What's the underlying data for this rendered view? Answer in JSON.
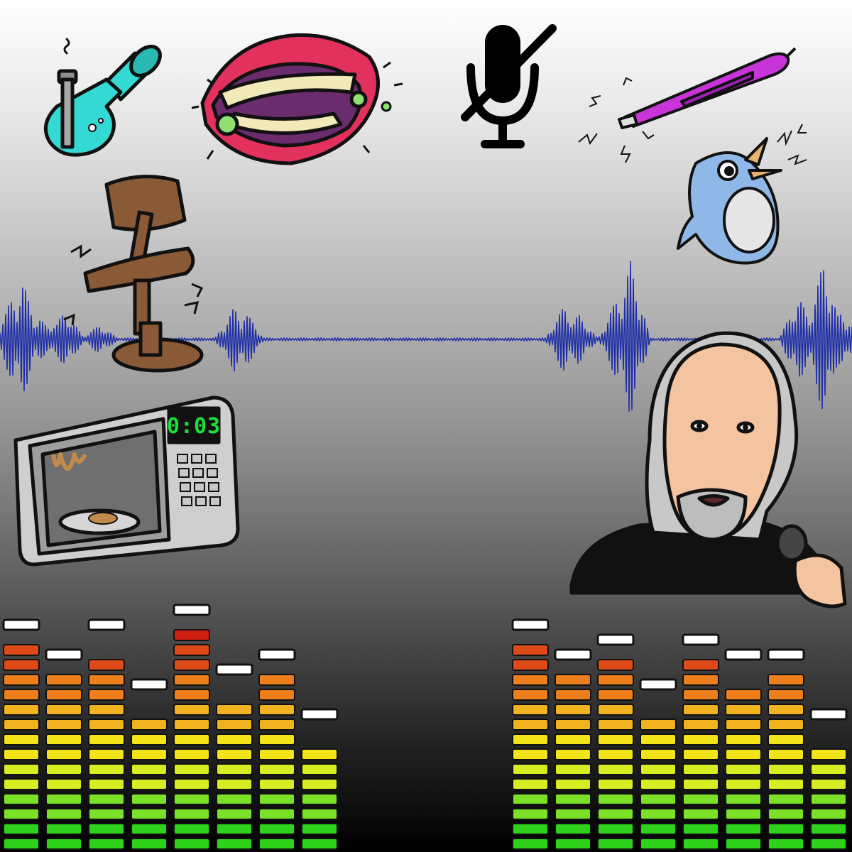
{
  "microwave": {
    "display": "0:03"
  },
  "colors": {
    "waveform": "#1f2fa8",
    "meter_gradient": [
      "#2ed11c",
      "#7be028",
      "#d8ec22",
      "#f2e418",
      "#f0b21e",
      "#ec7e1c",
      "#de4a17",
      "#d01e12"
    ],
    "peak_cap": "#ffffff",
    "bong_glass": "#35d9d3",
    "lips": "#e2315c",
    "pen": "#c734d8",
    "bird": "#8fb8e8",
    "chair": "#8a5a36",
    "microwave_body": "#cfcfcf",
    "shirt": "#111111",
    "skin": "#f4c39f"
  },
  "icons": [
    "bong-icon",
    "teeth-chewing-icon",
    "mic-muted-icon",
    "clicking-pen-icon",
    "chirping-bird-icon",
    "squeaky-chair-icon",
    "microwave-icon",
    "man-with-microphone"
  ],
  "meters": {
    "left": [
      {
        "level": 0.86,
        "peak": 0.93
      },
      {
        "level": 0.73,
        "peak": 0.83
      },
      {
        "level": 0.82,
        "peak": 0.91
      },
      {
        "level": 0.58,
        "peak": 0.68
      },
      {
        "level": 0.92,
        "peak": 1.0
      },
      {
        "level": 0.62,
        "peak": 0.72
      },
      {
        "level": 0.74,
        "peak": 0.83
      },
      {
        "level": 0.45,
        "peak": 0.55
      }
    ],
    "right": [
      {
        "level": 0.86,
        "peak": 0.93
      },
      {
        "level": 0.73,
        "peak": 0.81
      },
      {
        "level": 0.8,
        "peak": 0.88
      },
      {
        "level": 0.56,
        "peak": 0.68
      },
      {
        "level": 0.8,
        "peak": 0.87
      },
      {
        "level": 0.71,
        "peak": 0.81
      },
      {
        "level": 0.73,
        "peak": 0.82
      },
      {
        "level": 0.45,
        "peak": 0.55
      }
    ]
  }
}
